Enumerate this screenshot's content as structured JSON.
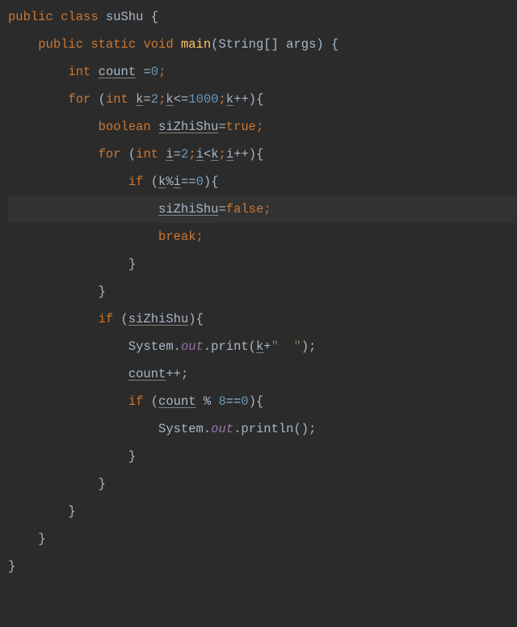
{
  "code": {
    "l1": {
      "kw1": "public class ",
      "cls": "suShu ",
      "b": "{"
    },
    "l2": {
      "kw": "public static void ",
      "m": "main",
      "p": "(String[] args) {"
    },
    "l3": {
      "kw": "int ",
      "v": "count",
      "rest": " =",
      "n": "0",
      "semi": ";"
    },
    "l4": {
      "kw1": "for ",
      "p1": "(",
      "kw2": "int ",
      "v": "k",
      "a": "=",
      "n1": "2",
      "semi1": ";",
      "v2": "k",
      "op": "<=",
      "n2": "1000",
      "semi2": ";",
      "v3": "k",
      "inc": "++){"
    },
    "l5": {
      "kw": "boolean ",
      "v": "siZhiShu",
      "eq": "=",
      "val": "true",
      "semi": ";"
    },
    "l6": {
      "kw1": "for ",
      "p1": "(",
      "kw2": "int ",
      "v": "i",
      "a": "=",
      "n1": "2",
      "semi1": ";",
      "v2": "i",
      "op": "<",
      "v3": "k",
      "semi2": ";",
      "v4": "i",
      "inc": "++){"
    },
    "l7": {
      "kw": "if ",
      "p1": "(",
      "v1": "k",
      "op": "%",
      "v2": "i",
      "eq": "==",
      "n": "0",
      "p2": "){"
    },
    "l8": {
      "v": "siZhiShu",
      "eq": "=",
      "val": "false",
      "semi": ";"
    },
    "l9": {
      "kw": "break",
      "semi": ";"
    },
    "l10": {
      "b": "}"
    },
    "l11": {
      "b": "}"
    },
    "l12": {
      "kw": "if ",
      "p1": "(",
      "v": "siZhiShu",
      "p2": "){"
    },
    "l13": {
      "sys": "System.",
      "out": "out",
      "dot": ".print(",
      "v": "k",
      "plus": "+",
      "str": "\"  \"",
      "p": ");"
    },
    "l14": {
      "v": "count",
      "inc": "++;"
    },
    "l15": {
      "kw": "if ",
      "p1": "(",
      "v": "count",
      "op": " % ",
      "n1": "8",
      "eq": "==",
      "n2": "0",
      "p2": "){"
    },
    "l16": {
      "sys": "System.",
      "out": "out",
      "rest": ".println();"
    },
    "l17": {
      "b": "}"
    },
    "l18": {
      "b": "}"
    },
    "l19": {
      "b": "}"
    },
    "l20": {
      "b": "}"
    },
    "l21": {
      "b": "}"
    }
  }
}
